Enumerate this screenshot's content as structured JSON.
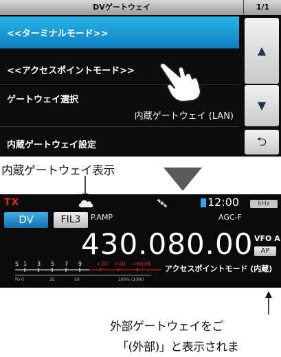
{
  "menu": {
    "title": "DVゲートウェイ",
    "page": "1/1",
    "items": [
      {
        "label": "<<ターミナルモード>>",
        "sub": ""
      },
      {
        "label": "<<アクセスポイントモード>>",
        "sub": ""
      },
      {
        "label": "ゲートウェイ選択",
        "sub": "内蔵ゲートウェイ (LAN)"
      },
      {
        "label": "内蔵ゲートウェイ設定",
        "sub": ""
      }
    ],
    "buttons": {
      "up": "▲",
      "down": "▼",
      "back": "⮌"
    }
  },
  "annotation": {
    "builtin": "内蔵ゲートウェイ表示",
    "external_line1": "外部ゲートウェイをご",
    "external_line2": "「(外部)」と表示されま"
  },
  "radio": {
    "tx": "TX",
    "clock": "12:00",
    "khz": "kHz",
    "mode": "DV",
    "filter": "FIL3",
    "pamp": "P.AMP",
    "agc": "AGC-F",
    "frequency": "430.080.00",
    "vfo": "VFO A",
    "ap": "AP",
    "ap_mode_text": "アクセスポイントモード (内蔵)",
    "smeter": {
      "scale": [
        "S",
        "1",
        "3",
        "5",
        "7",
        "9",
        "+20",
        "+40",
        "+60dB"
      ],
      "power_scale": [
        "Po 0",
        "25",
        "50",
        "100% (10W)"
      ]
    }
  },
  "colors": {
    "accent": "#1e8fd0",
    "tx": "#e02424",
    "red_scale": "#e02424"
  }
}
